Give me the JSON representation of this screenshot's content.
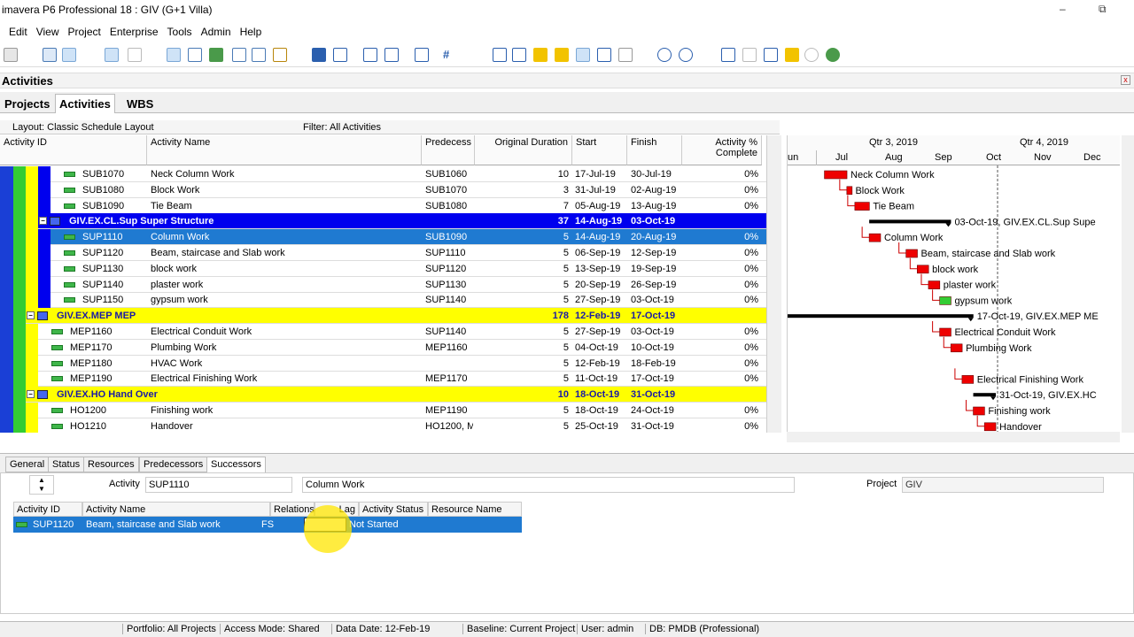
{
  "window": {
    "title": "imavera P6 Professional 18 : GIV (G+1 Villa)",
    "minimize": "–",
    "restore": "⧉"
  },
  "menu": [
    "Edit",
    "View",
    "Project",
    "Enterprise",
    "Tools",
    "Admin",
    "Help"
  ],
  "panel": {
    "title": "Activities",
    "close": "x"
  },
  "tabs": [
    "Projects",
    "Activities",
    "WBS"
  ],
  "layout_label": "Layout: Classic Schedule Layout",
  "filter_label": "Filter: All Activities",
  "columns": [
    "Activity ID",
    "Activity Name",
    "Predecess",
    "Original Duration",
    "Start",
    "Finish",
    "Activity % Complete"
  ],
  "rows": [
    {
      "type": "act",
      "level": 3,
      "id": "SUB1070",
      "name": "Neck Column Work",
      "pred": "SUB1060",
      "dur": "10",
      "start": "17-Jul-19",
      "finish": "30-Jul-19",
      "pct": "0%"
    },
    {
      "type": "act",
      "level": 3,
      "id": "SUB1080",
      "name": "Block Work",
      "pred": "SUB1070",
      "dur": "3",
      "start": "31-Jul-19",
      "finish": "02-Aug-19",
      "pct": "0%"
    },
    {
      "type": "act",
      "level": 3,
      "id": "SUB1090",
      "name": "Tie Beam",
      "pred": "SUB1080",
      "dur": "7",
      "start": "05-Aug-19",
      "finish": "13-Aug-19",
      "pct": "0%"
    },
    {
      "type": "wbs-blue",
      "level": 2,
      "id": "GIV.EX.CL.Sup  Super Structure",
      "name": "",
      "pred": "",
      "dur": "37",
      "start": "14-Aug-19",
      "finish": "03-Oct-19",
      "pct": ""
    },
    {
      "type": "selected",
      "level": 3,
      "id": "SUP1110",
      "name": "Column Work",
      "pred": "SUB1090",
      "dur": "5",
      "start": "14-Aug-19",
      "finish": "20-Aug-19",
      "pct": "0%"
    },
    {
      "type": "act",
      "level": 3,
      "id": "SUP1120",
      "name": "Beam, staircase and Slab work",
      "pred": "SUP1110",
      "dur": "5",
      "start": "06-Sep-19",
      "finish": "12-Sep-19",
      "pct": "0%"
    },
    {
      "type": "act",
      "level": 3,
      "id": "SUP1130",
      "name": "block work",
      "pred": "SUP1120",
      "dur": "5",
      "start": "13-Sep-19",
      "finish": "19-Sep-19",
      "pct": "0%"
    },
    {
      "type": "act",
      "level": 3,
      "id": "SUP1140",
      "name": "plaster work",
      "pred": "SUP1130",
      "dur": "5",
      "start": "20-Sep-19",
      "finish": "26-Sep-19",
      "pct": "0%"
    },
    {
      "type": "act",
      "level": 3,
      "id": "SUP1150",
      "name": "gypsum work",
      "pred": "SUP1140",
      "dur": "5",
      "start": "27-Sep-19",
      "finish": "03-Oct-19",
      "pct": "0%"
    },
    {
      "type": "wbs-yellow",
      "level": 1,
      "id": "GIV.EX.MEP  MEP",
      "name": "",
      "pred": "",
      "dur": "178",
      "start": "12-Feb-19",
      "finish": "17-Oct-19",
      "pct": ""
    },
    {
      "type": "act",
      "level": 2,
      "id": "MEP1160",
      "name": "Electrical Conduit Work",
      "pred": "SUP1140",
      "dur": "5",
      "start": "27-Sep-19",
      "finish": "03-Oct-19",
      "pct": "0%"
    },
    {
      "type": "act",
      "level": 2,
      "id": "MEP1170",
      "name": "Plumbing Work",
      "pred": "MEP1160",
      "dur": "5",
      "start": "04-Oct-19",
      "finish": "10-Oct-19",
      "pct": "0%"
    },
    {
      "type": "act",
      "level": 2,
      "id": "MEP1180",
      "name": "HVAC Work",
      "pred": "",
      "dur": "5",
      "start": "12-Feb-19",
      "finish": "18-Feb-19",
      "pct": "0%"
    },
    {
      "type": "act",
      "level": 2,
      "id": "MEP1190",
      "name": "Electrical Finishing Work",
      "pred": "MEP1170",
      "dur": "5",
      "start": "11-Oct-19",
      "finish": "17-Oct-19",
      "pct": "0%"
    },
    {
      "type": "wbs-yellow",
      "level": 1,
      "id": "GIV.EX.HO  Hand Over",
      "name": "",
      "pred": "",
      "dur": "10",
      "start": "18-Oct-19",
      "finish": "31-Oct-19",
      "pct": ""
    },
    {
      "type": "act",
      "level": 2,
      "id": "HO1200",
      "name": "Finishing work",
      "pred": "MEP1190",
      "dur": "5",
      "start": "18-Oct-19",
      "finish": "24-Oct-19",
      "pct": "0%"
    },
    {
      "type": "act",
      "level": 2,
      "id": "HO1210",
      "name": "Handover",
      "pred": "HO1200, M",
      "dur": "5",
      "start": "25-Oct-19",
      "finish": "31-Oct-19",
      "pct": "0%"
    }
  ],
  "gantt": {
    "quarters": [
      "Qtr 3, 2019",
      "Qtr 4, 2019"
    ],
    "months": [
      "un",
      "Jul",
      "Aug",
      "Sep",
      "Oct",
      "Nov",
      "Dec"
    ],
    "labels": [
      "Neck Column Work",
      "Block Work",
      "Tie Beam",
      "03-Oct-19, GIV.EX.CL.Sup  Supe",
      "Column Work",
      "Beam, staircase and Slab work",
      "block work",
      "plaster work",
      "gypsum work",
      "17-Oct-19, GIV.EX.MEP  ME",
      "Electrical Conduit Work",
      "Plumbing Work",
      "",
      "Electrical Finishing Work",
      "31-Oct-19, GIV.EX.HC",
      "Finishing work",
      "Handover"
    ],
    "colors": {
      "critical": "#ee0000",
      "normal": "#33cc33",
      "summary": "#000000"
    }
  },
  "bottom_tabs": [
    "General",
    "Status",
    "Resources",
    "Predecessors",
    "Successors"
  ],
  "detail": {
    "activity_label": "Activity",
    "activity_id": "SUP1110",
    "activity_name": "Column Work",
    "project_label": "Project",
    "project_value": "GIV",
    "successor_columns": [
      "Activity ID",
      "Activity Name",
      "Relations",
      "Lag",
      "Activity Status",
      "Resource Name"
    ],
    "successor_row": {
      "id": "SUP1120",
      "name": "Beam, staircase and Slab work",
      "rel": "FS",
      "lag": "",
      "status": "Not Started",
      "resource": ""
    }
  },
  "status": [
    "Portfolio: All Projects",
    "Access Mode: Shared",
    "Data Date: 12-Feb-19",
    "Baseline: Current Project",
    "User: admin",
    "DB: PMDB (Professional)"
  ]
}
